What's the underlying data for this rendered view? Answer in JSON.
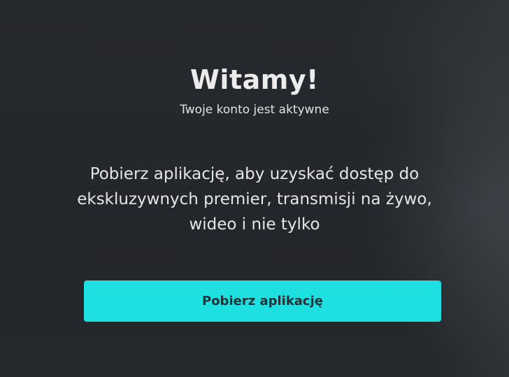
{
  "welcome": {
    "title": "Witamy!",
    "subtitle": "Twoje konto jest aktywne"
  },
  "description": {
    "line1": "Pobierz aplikację, aby uzyskać dostęp do",
    "line2": "ekskluzywnych premier, transmisji na żywo,",
    "line3": "wideo i nie tylko"
  },
  "actions": {
    "download_label": "Pobierz aplikację"
  },
  "colors": {
    "background": "#24272b",
    "accent": "#1fe0e0",
    "button_text": "#253238",
    "text": "#e8e8e8"
  }
}
